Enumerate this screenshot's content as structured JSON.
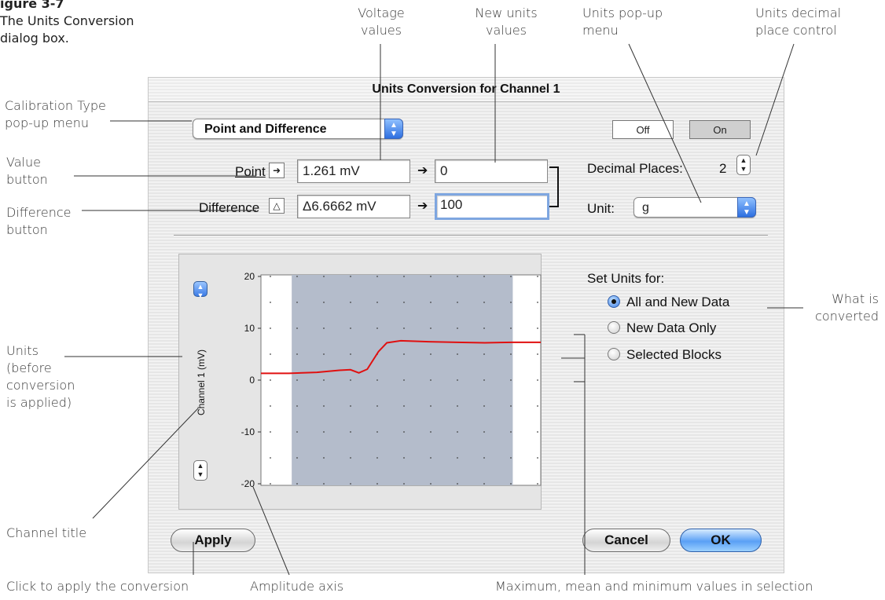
{
  "figure": {
    "number": "igure 3-7",
    "caption_lines": [
      "The Units Conversion",
      "dialog box."
    ]
  },
  "annotations": {
    "voltage_values": [
      "Voltage",
      "values"
    ],
    "new_units_values": [
      "New units",
      "values"
    ],
    "units_popup": [
      "Units pop-up",
      "menu"
    ],
    "decimal_control": [
      "Units decimal",
      "place control"
    ],
    "calibration_type": [
      "Calibration Type",
      "pop-up menu"
    ],
    "value_button": [
      "Value",
      "button"
    ],
    "difference_button": [
      "Difference",
      "button"
    ],
    "what_converted": [
      "What is",
      "converted"
    ],
    "units_before": [
      "Units",
      "(before",
      "conversion",
      "is applied)"
    ],
    "channel_title": "Channel title",
    "click_apply": "Click to apply the conversion",
    "amplitude_axis": "Amplitude axis",
    "max_mean_min": "Maximum, mean and minimum values in selection"
  },
  "dialog": {
    "title": "Units Conversion for Channel 1",
    "calibration_type": "Point and Difference",
    "off_label": "Off",
    "on_label": "On",
    "point_label": "Point",
    "difference_label": "Difference",
    "point_voltage": "1.261 mV",
    "difference_voltage": "Δ6.6662 mV",
    "point_new_value": "0",
    "difference_new_value": "100",
    "decimal_places_label": "Decimal Places:",
    "decimal_places_value": "2",
    "unit_label": "Unit:",
    "unit_value": "g",
    "set_units_label": "Set Units for:",
    "set_units_options": [
      "All and New Data",
      "New Data Only",
      "Selected Blocks"
    ],
    "set_units_selected": 0,
    "channel_title": "Channel 1 (mV)",
    "apply_label": "Apply",
    "cancel_label": "Cancel",
    "ok_label": "OK"
  },
  "colors": {
    "trace": "#e01010",
    "selection": "#b4bccb",
    "accent": "#3b7be6"
  },
  "chart_data": {
    "type": "line",
    "ylabel": "Channel 1 (mV)",
    "ylim": [
      -20,
      20
    ],
    "yticks": [
      20,
      10,
      0,
      -10,
      -20
    ],
    "ytick_labels": [
      "20",
      "10",
      "0",
      "-10",
      "-20"
    ],
    "grid": true,
    "xlim": [
      0,
      100
    ],
    "selection_x": [
      11,
      90
    ],
    "series": [
      {
        "x": [
          0,
          10,
          20,
          28,
          32,
          35,
          38,
          42,
          45,
          50,
          60,
          70,
          80,
          90,
          100
        ],
        "y": [
          1.3,
          1.3,
          1.5,
          1.9,
          2.0,
          1.4,
          2.1,
          5.5,
          7.2,
          7.6,
          7.4,
          7.3,
          7.2,
          7.3,
          7.3
        ]
      }
    ]
  }
}
